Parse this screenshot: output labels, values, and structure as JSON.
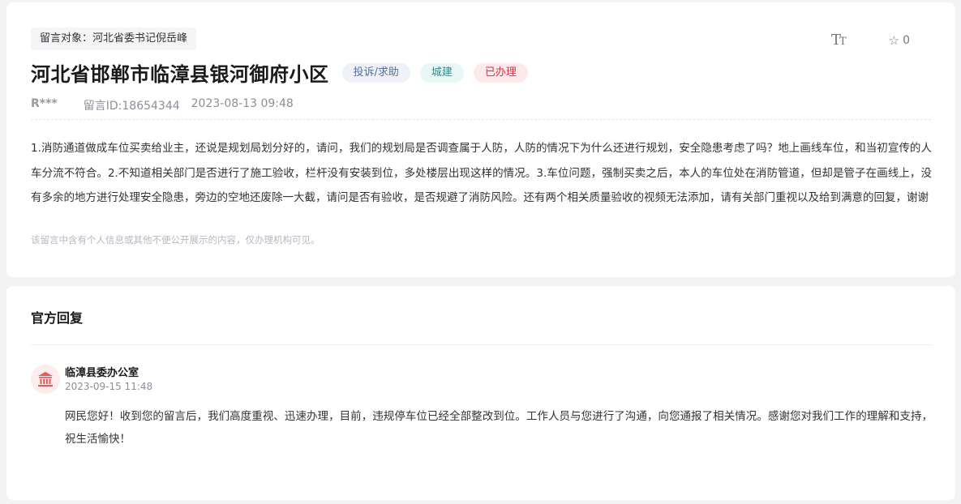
{
  "message": {
    "target": "留言对象：河北省委书记倪岳峰",
    "title": "河北省邯郸市临漳县银河御府小区",
    "tags": {
      "type": "投诉/求助",
      "category": "城建",
      "status": "已办理"
    },
    "author": "R***",
    "id_label": "留言ID:18654344",
    "time": "2023-08-13 09:48",
    "favorites": "0",
    "content": "1.消防通道做成车位买卖给业主，还说是规划局划分好的，请问，我们的规划局是否调查属于人防，人防的情况下为什么还进行规划，安全隐患考虑了吗？地上画线车位，和当初宣传的人车分流不符合。2.不知道相关部门是否进行了施工验收，栏杆没有安装到位，多处楼层出现这样的情况。3.车位问题，强制买卖之后，本人的车位处在消防管道，但却是管子在画线上，没有多余的地方进行处理安全隐患，旁边的空地还废除一大截，请问是否有验收，是否规避了消防风险。还有两个相关质量验收的视频无法添加，请有关部门重视以及给到满意的回复，谢谢",
    "notice": "该留言中含有个人信息或其他不便公开展示的内容，仅办理机构可见。"
  },
  "reply": {
    "section_title": "官方回复",
    "department": "临漳县委办公室",
    "time": "2023-09-15 11:48",
    "content": "网民您好！收到您的留言后，我们高度重视、迅速办理，目前，违规停车位已经全部整改到位。工作人员与您进行了沟通，向您通报了相关情况。感谢您对我们工作的理解和支持，祝生活愉快！"
  },
  "icons": {
    "font_size": "font-size-icon",
    "favorite": "star-outline-icon",
    "avatar": "government-building-icon"
  },
  "colors": {
    "status_red": "#d6344a",
    "category_teal": "#2f8c88",
    "type_blue": "#5a6f93"
  }
}
